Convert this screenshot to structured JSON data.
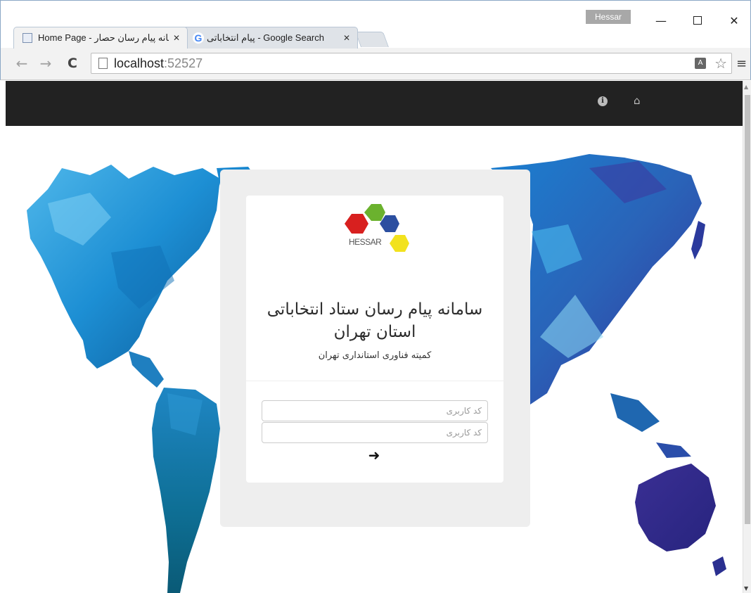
{
  "window": {
    "profile_name": "Hessar",
    "minimize_glyph": "—",
    "close_glyph": "✕"
  },
  "tabs": [
    {
      "title": "Home Page - سامانه پیام رسان حصار",
      "favicon": "page-icon",
      "close": "✕",
      "active": true
    },
    {
      "title": "پیام انتخاباتی - Google Search",
      "favicon": "google-icon",
      "close": "✕",
      "active": false
    }
  ],
  "toolbar": {
    "back_glyph": "←",
    "forward_glyph": "→",
    "reload_glyph": "C",
    "url_host": "localhost",
    "url_port": ":52527",
    "menu_glyph": "≡"
  },
  "navbar": {
    "background": "#222222",
    "info_glyph": "i",
    "home_glyph": "⌂"
  },
  "login": {
    "logo_text": "HESSAR",
    "title": "سامانه پیام رسان ستاد انتخاباتی استان تهران",
    "subtitle": "کمیته فناوری استانداری تهران",
    "username_placeholder": "کد کاربری",
    "password_placeholder": "کد کاربری",
    "submit_glyph": "➜"
  }
}
